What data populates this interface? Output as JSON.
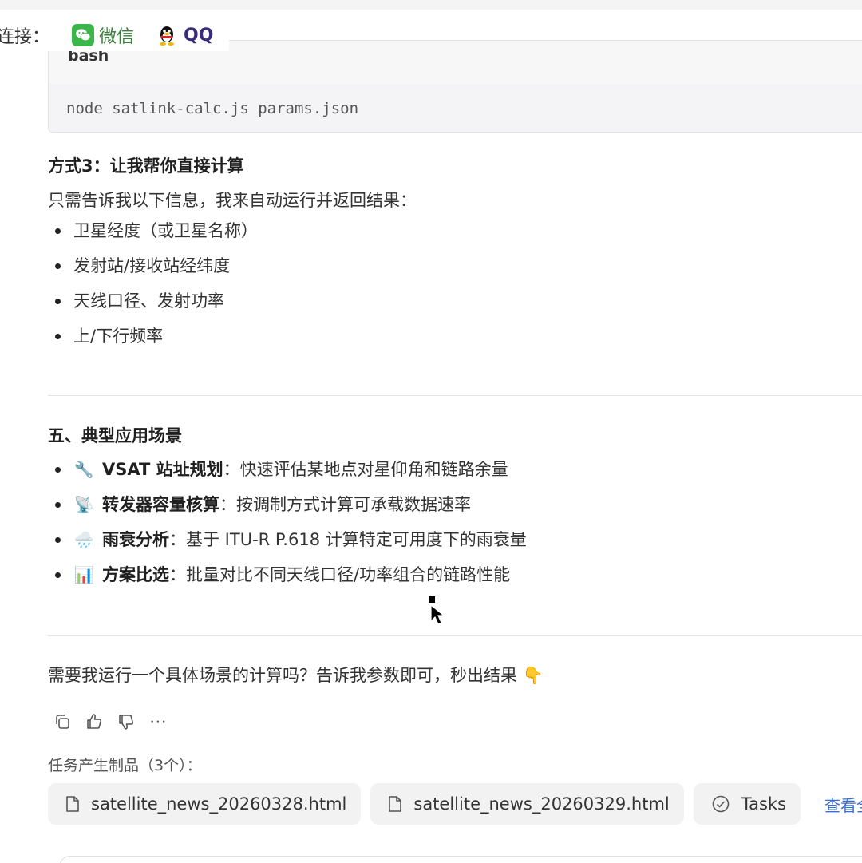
{
  "connect": {
    "label": "连接：",
    "wechat": "微信",
    "qq": "QQ"
  },
  "code": {
    "lang": "bash",
    "command": "node satlink-calc.js params.json"
  },
  "method3": {
    "title": "方式3：让我帮你直接计算",
    "intro": "只需告诉我以下信息，我来自动运行并返回结果：",
    "items": [
      "卫星经度（或卫星名称）",
      "发射站/接收站经纬度",
      "天线口径、发射功率",
      "上/下行频率"
    ]
  },
  "section5": {
    "title": "五、典型应用场景",
    "items": [
      {
        "emoji": "🔧",
        "name": "VSAT 站址规划",
        "desc": "：快速评估某地点对星仰角和链路余量"
      },
      {
        "emoji": "📡",
        "name": "转发器容量核算",
        "desc": "：按调制方式计算可承载数据速率"
      },
      {
        "emoji": "🌧️",
        "name": "雨衰分析",
        "desc": "：基于 ITU-R P.618 计算特定可用度下的雨衰量"
      },
      {
        "emoji": "📊",
        "name": "方案比选",
        "desc": "：批量对比不同天线口径/功率组合的链路性能"
      }
    ]
  },
  "closing": "需要我运行一个具体场景的计算吗？告诉我参数即可，秒出结果 👇",
  "actions": {
    "copy": "copy-icon",
    "like": "thumbs-up-icon",
    "dislike": "thumbs-down-icon",
    "more": "⋯"
  },
  "artifacts": {
    "label": "任务产生制品（3个）：",
    "files": [
      "satellite_news_20260328.html",
      "satellite_news_20260329.html",
      "Tasks"
    ],
    "view_all": "查看全"
  },
  "colors": {
    "wechat": "#3cb64a",
    "qq_text": "#3a2c78",
    "link": "#3a6fd1"
  }
}
